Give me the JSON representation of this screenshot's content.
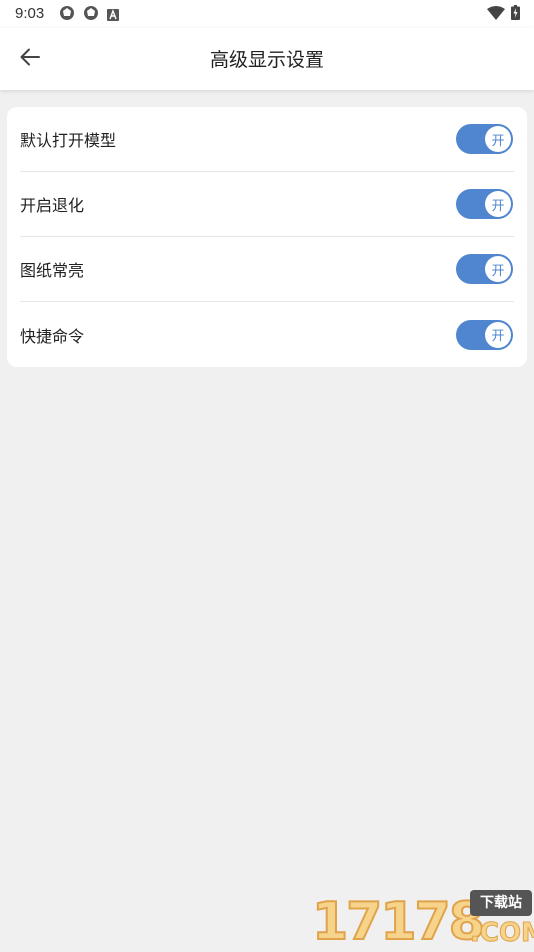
{
  "status_bar": {
    "time": "9:03",
    "left_icons": [
      "aperture-icon",
      "aperture-icon",
      "font-a-icon"
    ],
    "right_icons": [
      "wifi-icon",
      "battery-charging-icon"
    ]
  },
  "app_bar": {
    "back_icon": "arrow-left-icon",
    "title": "高级显示设置"
  },
  "settings": [
    {
      "label": "默认打开模型",
      "toggle_on": true,
      "toggle_text": "开"
    },
    {
      "label": "开启退化",
      "toggle_on": true,
      "toggle_text": "开"
    },
    {
      "label": "图纸常亮",
      "toggle_on": true,
      "toggle_text": "开"
    },
    {
      "label": "快捷命令",
      "toggle_on": true,
      "toggle_text": "开"
    }
  ],
  "colors": {
    "accent": "#4f86cf",
    "background": "#f0f0f0",
    "card": "#ffffff"
  },
  "watermark": {
    "digits": "17178",
    "badge": "下载站",
    "domain": ".COM"
  }
}
